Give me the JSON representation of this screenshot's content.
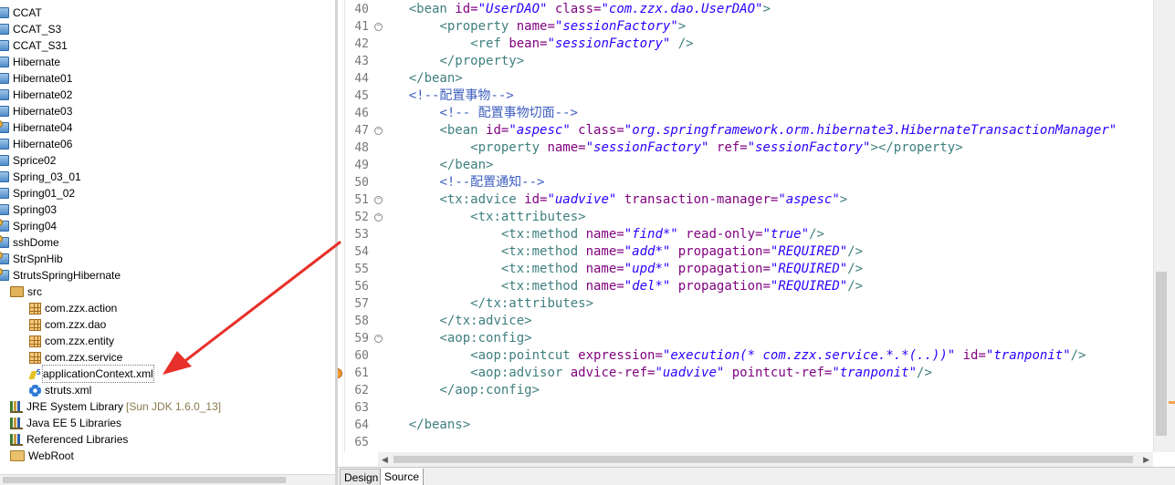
{
  "explorer": {
    "projects": [
      {
        "label": "CCAT",
        "icon": "project-icon"
      },
      {
        "label": "CCAT_S3",
        "icon": "project-icon"
      },
      {
        "label": "CCAT_S31",
        "icon": "project-icon"
      },
      {
        "label": "Hibernate",
        "icon": "project-icon"
      },
      {
        "label": "Hibernate01",
        "icon": "project-icon"
      },
      {
        "label": "Hibernate02",
        "icon": "project-icon"
      },
      {
        "label": "Hibernate03",
        "icon": "project-icon"
      },
      {
        "label": "Hibernate04",
        "icon": "web-project-icon"
      },
      {
        "label": "Hibernate06",
        "icon": "project-icon"
      },
      {
        "label": "Sprice02",
        "icon": "spring-project-icon"
      },
      {
        "label": "Spring_03_01",
        "icon": "spring-project-icon"
      },
      {
        "label": "Spring01_02",
        "icon": "spring-project-icon"
      },
      {
        "label": "Spring03",
        "icon": "project-icon"
      },
      {
        "label": "Spring04",
        "icon": "web-project-icon"
      },
      {
        "label": "sshDome",
        "icon": "web-project-icon"
      },
      {
        "label": "StrSpnHib",
        "icon": "web-project-icon"
      },
      {
        "label": "StrutsSpringHibernate",
        "icon": "web-project-icon"
      }
    ],
    "src_folder": "src",
    "packages": [
      "com.zzx.action",
      "com.zzx.dao",
      "com.zzx.entity",
      "com.zzx.service"
    ],
    "files": [
      {
        "label": "applicationContext.xml",
        "icon": "spring-xml-icon"
      },
      {
        "label": "struts.xml",
        "icon": "gear-icon"
      }
    ],
    "libraries": [
      {
        "label": "JRE System Library",
        "suffix": "[Sun JDK 1.6.0_13]",
        "icon": "library-icon"
      },
      {
        "label": "Java EE 5 Libraries",
        "suffix": "",
        "icon": "library-icon"
      },
      {
        "label": "Referenced Libraries",
        "suffix": "",
        "icon": "library-icon"
      },
      {
        "label": "WebRoot",
        "suffix": "",
        "icon": "folder-icon"
      }
    ]
  },
  "editor": {
    "first_line": 40,
    "lines": [
      [
        [
          "plain",
          "    "
        ],
        [
          "tag",
          "<bean "
        ],
        [
          "attr",
          "id="
        ],
        [
          "val",
          "\"UserDAO\""
        ],
        [
          "attr",
          " class="
        ],
        [
          "val",
          "\"com.zzx.dao.UserDAO\""
        ],
        [
          "tag",
          ">"
        ]
      ],
      [
        [
          "plain",
          "        "
        ],
        [
          "tag",
          "<property "
        ],
        [
          "attr",
          "name="
        ],
        [
          "val",
          "\"sessionFactory\""
        ],
        [
          "tag",
          ">"
        ]
      ],
      [
        [
          "plain",
          "            "
        ],
        [
          "tag",
          "<ref "
        ],
        [
          "attr",
          "bean="
        ],
        [
          "val",
          "\"sessionFactory\""
        ],
        [
          "tag",
          " />"
        ]
      ],
      [
        [
          "plain",
          "        "
        ],
        [
          "tag",
          "</property>"
        ]
      ],
      [
        [
          "plain",
          "    "
        ],
        [
          "tag",
          "</bean>"
        ]
      ],
      [
        [
          "plain",
          "    "
        ],
        [
          "comment",
          "<!--配置事物-->"
        ]
      ],
      [
        [
          "plain",
          "        "
        ],
        [
          "comment",
          "<!-- 配置事物切面-->"
        ]
      ],
      [
        [
          "plain",
          "        "
        ],
        [
          "tag",
          "<bean "
        ],
        [
          "attr",
          "id="
        ],
        [
          "val",
          "\"aspesc\""
        ],
        [
          "attr",
          " class="
        ],
        [
          "val",
          "\"org.springframework.orm.hibernate3.HibernateTransactionManager\""
        ]
      ],
      [
        [
          "plain",
          "            "
        ],
        [
          "tag",
          "<property "
        ],
        [
          "attr",
          "name="
        ],
        [
          "val",
          "\"sessionFactory\""
        ],
        [
          "attr",
          " ref="
        ],
        [
          "val",
          "\"sessionFactory\""
        ],
        [
          "tag",
          "></property>"
        ]
      ],
      [
        [
          "plain",
          "        "
        ],
        [
          "tag",
          "</bean>"
        ]
      ],
      [
        [
          "plain",
          "        "
        ],
        [
          "comment",
          "<!--配置通知-->"
        ]
      ],
      [
        [
          "plain",
          "        "
        ],
        [
          "tag",
          "<tx:advice "
        ],
        [
          "attr",
          "id="
        ],
        [
          "val",
          "\"uadvive\""
        ],
        [
          "attr",
          " transaction-manager="
        ],
        [
          "val",
          "\"aspesc\""
        ],
        [
          "tag",
          ">"
        ]
      ],
      [
        [
          "plain",
          "            "
        ],
        [
          "tag",
          "<tx:attributes>"
        ]
      ],
      [
        [
          "plain",
          "                "
        ],
        [
          "tag",
          "<tx:method "
        ],
        [
          "attr",
          "name="
        ],
        [
          "val",
          "\"find*\""
        ],
        [
          "attr",
          " read-only="
        ],
        [
          "val",
          "\"true\""
        ],
        [
          "tag",
          "/>"
        ]
      ],
      [
        [
          "plain",
          "                "
        ],
        [
          "tag",
          "<tx:method "
        ],
        [
          "attr",
          "name="
        ],
        [
          "val",
          "\"add*\""
        ],
        [
          "attr",
          " propagation="
        ],
        [
          "val",
          "\"REQUIRED\""
        ],
        [
          "tag",
          "/>"
        ]
      ],
      [
        [
          "plain",
          "                "
        ],
        [
          "tag",
          "<tx:method "
        ],
        [
          "attr",
          "name="
        ],
        [
          "val",
          "\"upd*\""
        ],
        [
          "attr",
          " propagation="
        ],
        [
          "val",
          "\"REQUIRED\""
        ],
        [
          "tag",
          "/>"
        ]
      ],
      [
        [
          "plain",
          "                "
        ],
        [
          "tag",
          "<tx:method "
        ],
        [
          "attr",
          "name="
        ],
        [
          "val",
          "\"del*\""
        ],
        [
          "attr",
          " propagation="
        ],
        [
          "val",
          "\"REQUIRED\""
        ],
        [
          "tag",
          "/>"
        ]
      ],
      [
        [
          "plain",
          "            "
        ],
        [
          "tag",
          "</tx:attributes>"
        ]
      ],
      [
        [
          "plain",
          "        "
        ],
        [
          "tag",
          "</tx:advice>"
        ]
      ],
      [
        [
          "plain",
          "        "
        ],
        [
          "tag",
          "<aop:config>"
        ]
      ],
      [
        [
          "plain",
          "            "
        ],
        [
          "tag",
          "<aop:pointcut "
        ],
        [
          "attr",
          "expression="
        ],
        [
          "val",
          "\"execution(* com.zzx.service.*.*(..))\""
        ],
        [
          "attr",
          " id="
        ],
        [
          "val",
          "\"tranponit\""
        ],
        [
          "tag",
          "/>"
        ]
      ],
      [
        [
          "plain",
          "            "
        ],
        [
          "tag",
          "<aop:advisor "
        ],
        [
          "attr",
          "advice-ref="
        ],
        [
          "val",
          "\"uadvive\""
        ],
        [
          "attr",
          " pointcut-ref="
        ],
        [
          "val",
          "\"tranponit\""
        ],
        [
          "tag",
          "/>"
        ]
      ],
      [
        [
          "plain",
          "        "
        ],
        [
          "tag",
          "</aop:config>"
        ]
      ],
      [
        [
          "plain",
          ""
        ]
      ],
      [
        [
          "plain",
          "    "
        ],
        [
          "tag",
          "</beans>"
        ]
      ],
      [
        [
          "plain",
          ""
        ]
      ]
    ],
    "fold_lines": [
      41,
      47,
      51,
      52,
      59
    ],
    "warning_line": 61,
    "tabs": {
      "design": "Design",
      "source": "Source"
    }
  },
  "colors": {
    "tag": "#3f7f7f",
    "attribute": "#7f007f",
    "value": "#2a00ff",
    "comment": "#3f5fbf",
    "annotation_arrow": "#e8302a"
  }
}
